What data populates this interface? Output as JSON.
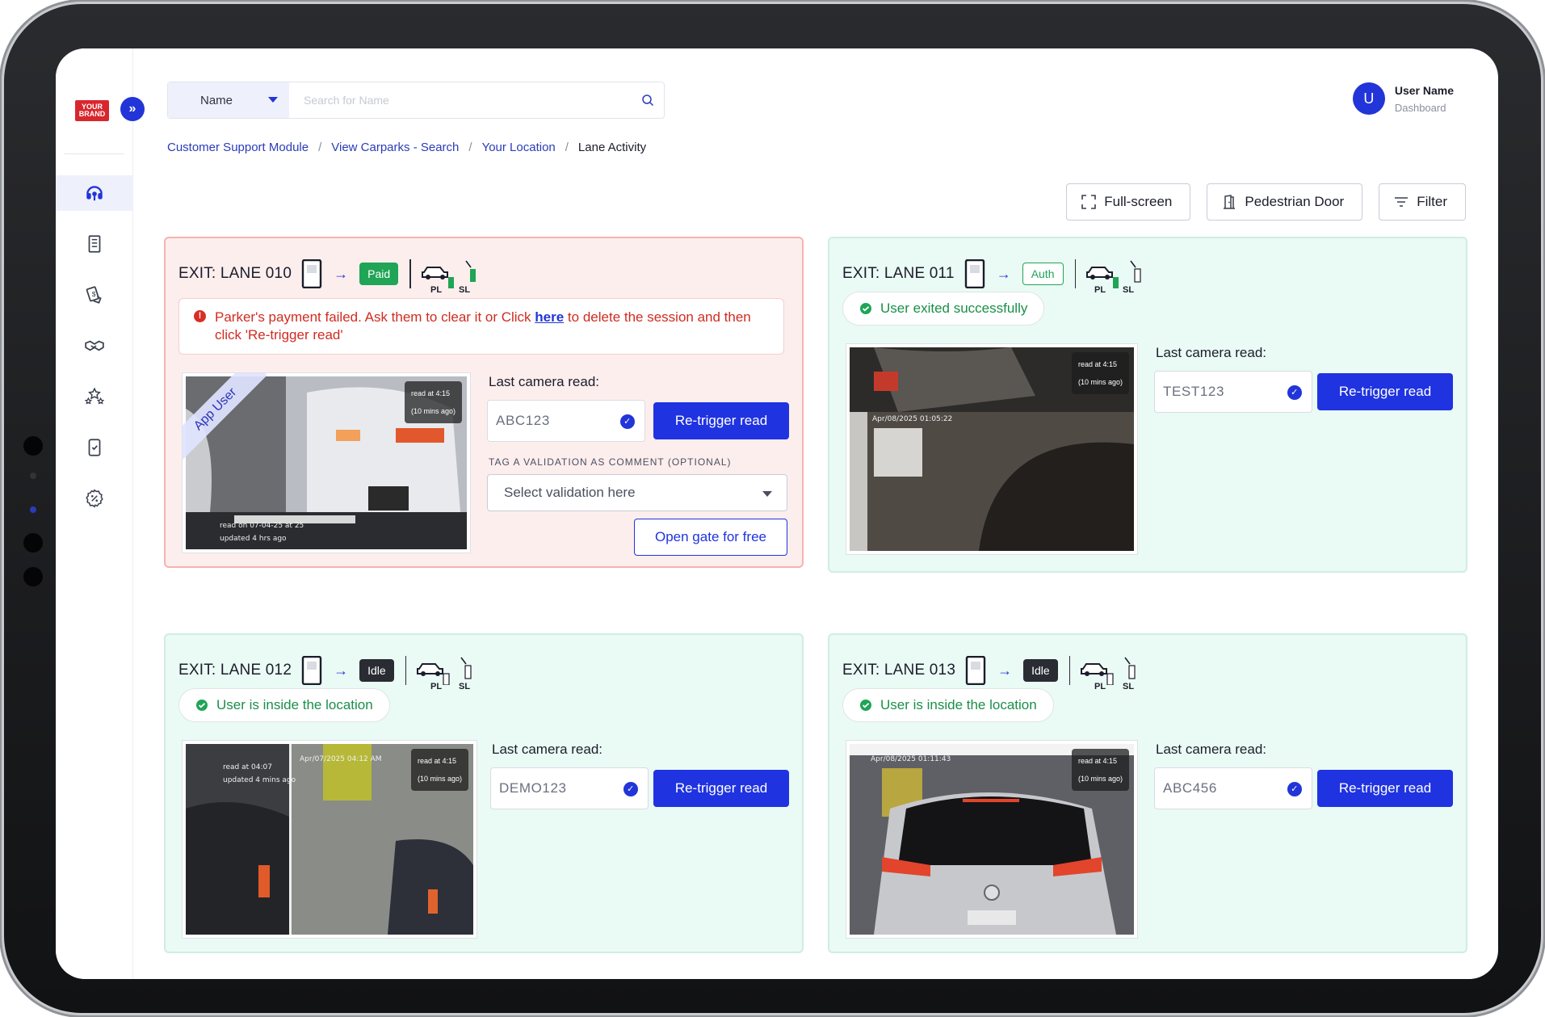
{
  "brand": {
    "logo_line1": "YOUR",
    "logo_line2": "BRAND"
  },
  "search": {
    "field_label": "Name",
    "placeholder": "Search for Name"
  },
  "user": {
    "initial": "U",
    "name": "User Name",
    "role": "Dashboard"
  },
  "breadcrumb": [
    "Customer Support Module",
    "View Carparks - Search",
    "Your Location",
    "Lane Activity"
  ],
  "toolbar": {
    "fullscreen": "Full-screen",
    "pedestrian": "Pedestrian Door",
    "filter": "Filter"
  },
  "common": {
    "last_read": "Last camera read:",
    "retrigger": "Re-trigger read",
    "pl": "PL",
    "sl": "SL",
    "read_at": "read at 4:15",
    "ago": "(10 mins ago)"
  },
  "lanes": [
    {
      "title": "EXIT: LANE 010",
      "status": "Paid",
      "alert_pre": "Parker's payment failed. Ask them to clear it or Click ",
      "alert_link": "here",
      "alert_post": " to delete the session and then click 'Re-trigger read'",
      "plate": "ABC123",
      "ribbon": "App User",
      "cam_read": "read on 07-04-25 at 25",
      "cam_updated": "updated 4 hrs ago",
      "tag_label": "TAG A VALIDATION AS COMMENT (OPTIONAL)",
      "select_placeholder": "Select validation here",
      "open_gate": "Open gate for free"
    },
    {
      "title": "EXIT: LANE 011",
      "status": "Auth",
      "message": "User exited successfully",
      "plate": "TEST123",
      "cam_stamp": "Apr/08/2025 01:05:22"
    },
    {
      "title": "EXIT: LANE 012",
      "status": "Idle",
      "message": "User is inside the location",
      "plate": "DEMO123",
      "cam_read": "read at 04:07",
      "cam_updated": "updated 4 mins ago",
      "cam_stamp": "Apr/07/2025 04:12 AM"
    },
    {
      "title": "EXIT: LANE 013",
      "status": "Idle",
      "message": "User is inside the location",
      "plate": "ABC456",
      "cam_stamp": "Apr/08/2025 01:11:43"
    }
  ],
  "colors": {
    "accent": "#1f33e0",
    "success": "#1fa557",
    "error": "#d82f25",
    "alert_bg": "#fdeeee",
    "ok_bg": "#eafaf4"
  }
}
